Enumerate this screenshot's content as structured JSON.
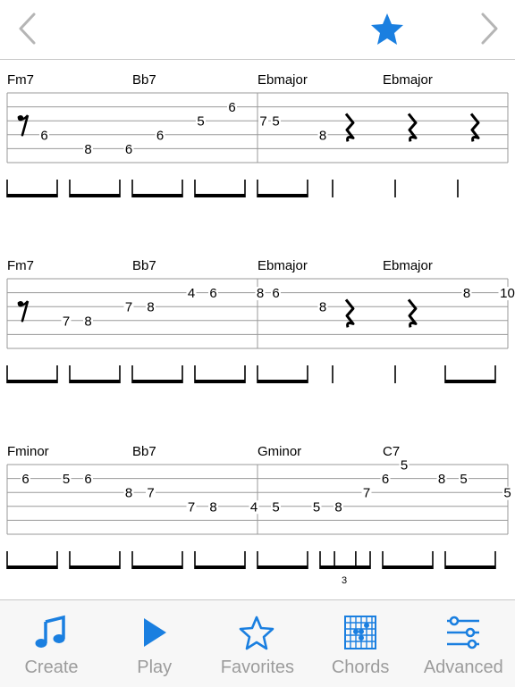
{
  "toolbar": {
    "prev": "chevron-left-icon",
    "favorite": "star-icon",
    "next": "chevron-right-icon",
    "accent": "#1a7fe0"
  },
  "systems": [
    {
      "chords": [
        "Fm7",
        "Bb7",
        "Ebmajor",
        "Ebmajor"
      ],
      "notes": [
        {
          "beat": 0.45,
          "string": 3,
          "fret": "6"
        },
        {
          "beat": 1.15,
          "string": 4,
          "fret": "8"
        },
        {
          "beat": 1.8,
          "string": 4,
          "fret": "6"
        },
        {
          "beat": 2.3,
          "string": 3,
          "fret": "6"
        },
        {
          "beat": 2.95,
          "string": 2,
          "fret": "5"
        },
        {
          "beat": 3.45,
          "string": 1,
          "fret": "6"
        },
        {
          "beat": 3.95,
          "string": 2,
          "fret": "7"
        },
        {
          "beat": 4.15,
          "string": 2,
          "fret": "5"
        },
        {
          "beat": 4.9,
          "string": 3,
          "fret": "8"
        }
      ],
      "eighthRests": [
        0.1
      ],
      "quarterRests": [
        5.3,
        6.3,
        7.3
      ],
      "beams": [
        [
          0,
          1
        ],
        [
          1,
          2
        ],
        [
          2,
          3
        ],
        [
          3,
          4
        ],
        [
          4,
          5
        ]
      ],
      "stems": [
        5.3,
        6.3,
        7.3
      ],
      "tuplets": []
    },
    {
      "chords": [
        "Fm7",
        "Bb7",
        "Ebmajor",
        "Ebmajor"
      ],
      "notes": [
        {
          "beat": 0.8,
          "string": 3,
          "fret": "7"
        },
        {
          "beat": 1.15,
          "string": 3,
          "fret": "8"
        },
        {
          "beat": 1.8,
          "string": 2,
          "fret": "7"
        },
        {
          "beat": 2.15,
          "string": 2,
          "fret": "8"
        },
        {
          "beat": 2.8,
          "string": 1,
          "fret": "4"
        },
        {
          "beat": 3.15,
          "string": 1,
          "fret": "6"
        },
        {
          "beat": 3.9,
          "string": 1,
          "fret": "8"
        },
        {
          "beat": 4.15,
          "string": 1,
          "fret": "6"
        },
        {
          "beat": 4.9,
          "string": 2,
          "fret": "8"
        },
        {
          "beat": 7.2,
          "string": 1,
          "fret": "8"
        },
        {
          "beat": 7.85,
          "string": 1,
          "fret": "10"
        }
      ],
      "eighthRests": [
        0.1
      ],
      "quarterRests": [
        5.3,
        6.3
      ],
      "beams": [
        [
          0,
          1
        ],
        [
          1,
          2
        ],
        [
          2,
          3
        ],
        [
          3,
          4
        ],
        [
          4,
          5
        ],
        [
          7,
          8
        ]
      ],
      "stems": [
        5.3,
        6.3
      ],
      "tuplets": []
    },
    {
      "chords": [
        "Fminor",
        "Bb7",
        "Gminor",
        "C7"
      ],
      "notes": [
        {
          "beat": 0.15,
          "string": 1,
          "fret": "6"
        },
        {
          "beat": 0.8,
          "string": 1,
          "fret": "5"
        },
        {
          "beat": 1.15,
          "string": 1,
          "fret": "6"
        },
        {
          "beat": 1.8,
          "string": 2,
          "fret": "8"
        },
        {
          "beat": 2.15,
          "string": 2,
          "fret": "7"
        },
        {
          "beat": 2.8,
          "string": 3,
          "fret": "7"
        },
        {
          "beat": 3.15,
          "string": 3,
          "fret": "8"
        },
        {
          "beat": 3.8,
          "string": 3,
          "fret": "4"
        },
        {
          "beat": 4.15,
          "string": 3,
          "fret": "5"
        },
        {
          "beat": 4.8,
          "string": 3,
          "fret": "5"
        },
        {
          "beat": 5.15,
          "string": 3,
          "fret": "8"
        },
        {
          "beat": 5.6,
          "string": 2,
          "fret": "7"
        },
        {
          "beat": 5.9,
          "string": 1,
          "fret": "6"
        },
        {
          "beat": 6.2,
          "string": 0,
          "fret": "5"
        },
        {
          "beat": 6.8,
          "string": 1,
          "fret": "8"
        },
        {
          "beat": 7.15,
          "string": 1,
          "fret": "5"
        },
        {
          "beat": 7.85,
          "string": 2,
          "fret": "5"
        }
      ],
      "eighthRests": [],
      "quarterRests": [],
      "beams": [
        [
          0,
          1
        ],
        [
          1,
          2
        ],
        [
          2,
          3
        ],
        [
          3,
          4
        ],
        [
          4,
          5
        ],
        [
          5.0,
          6.0
        ],
        [
          6,
          7
        ],
        [
          7,
          8
        ]
      ],
      "stems": [],
      "tuplets": [
        {
          "start": 5.0,
          "end": 6.0,
          "label": "3",
          "mid": [
            5.33,
            5.67
          ]
        }
      ]
    }
  ],
  "tabs": [
    {
      "icon": "music-note-icon",
      "label": "Create"
    },
    {
      "icon": "play-icon",
      "label": "Play"
    },
    {
      "icon": "star-outline-icon",
      "label": "Favorites"
    },
    {
      "icon": "chord-grid-icon",
      "label": "Chords"
    },
    {
      "icon": "sliders-icon",
      "label": "Advanced"
    }
  ]
}
